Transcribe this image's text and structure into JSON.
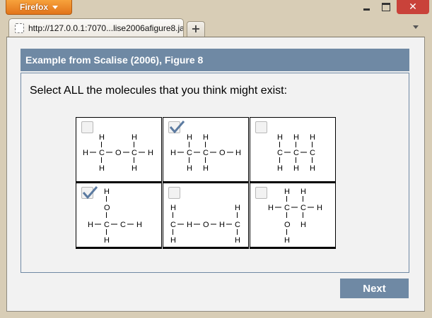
{
  "browser": {
    "app_button": "Firefox",
    "tab_title": "http://127.0.0.1:7070...lise2006afigure8.jar/",
    "new_tab_label": "+",
    "close_label": "✕"
  },
  "page": {
    "header": "Example from Scalise (2006), Figure 8",
    "prompt": "Select ALL the molecules that you think might exist:",
    "next_label": "Next"
  },
  "molecules": [
    {
      "checked": false
    },
    {
      "checked": true
    },
    {
      "checked": false
    },
    {
      "checked": true
    },
    {
      "checked": false
    },
    {
      "checked": false
    }
  ],
  "atoms": {
    "H": "H",
    "C": "C",
    "O": "O"
  },
  "colors": {
    "accent": "#6f89a4",
    "check": "#5b7aa0"
  }
}
